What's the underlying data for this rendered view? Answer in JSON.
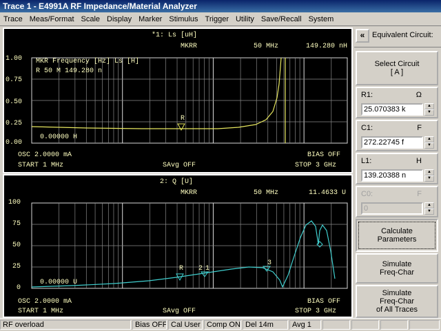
{
  "window": {
    "title": "Trace 1  -  E4991A RF Impedance/Material Analyzer"
  },
  "menu": [
    "Trace",
    "Meas/Format",
    "Scale",
    "Display",
    "Marker",
    "Stimulus",
    "Trigger",
    "Utility",
    "Save/Recall",
    "System"
  ],
  "trace1": {
    "title": "*1: Ls [uH]",
    "mkr_mode": "MKRR",
    "mkr_freq": "50 MHz",
    "mkr_value": "149.280 nH",
    "table_header": "MKR  Frequency  [Hz]       Ls [H]",
    "table_row": " R              50 M    149.280 n",
    "yticks": [
      "1.00",
      "0.75",
      "0.50",
      "0.25",
      "0.00"
    ],
    "ref_value": "0.00000 H",
    "osc": "OSC 2.0000 mA",
    "bias": "BIAS OFF",
    "start": "START  1 MHz",
    "savg": "SAvg OFF",
    "stop": "STOP  3 GHz",
    "marker_label": "R",
    "trace_color": "#e8e860"
  },
  "trace2": {
    "title": "2: Q [U]",
    "mkr_mode": "MKRR",
    "mkr_freq": "50 MHz",
    "mkr_value": "11.4633 U",
    "yticks": [
      "100",
      "75",
      "50",
      "25",
      "0"
    ],
    "ref_value": "0.00000 U",
    "osc": "OSC 2.0000 mA",
    "bias": "BIAS OFF",
    "start": "START  1 MHz",
    "savg": "SAvg OFF",
    "stop": "STOP  3 GHz",
    "marker_labels": [
      "R",
      "2",
      "1",
      "3"
    ],
    "trace_color": "#40d0d0"
  },
  "side": {
    "back": "«",
    "title": "Equivalent Circuit:",
    "select_circuit": "Select Circuit",
    "select_circuit_value": "[ A ]",
    "fields": [
      {
        "label": "R1:",
        "unit": "Ω",
        "value": "25.070383 k",
        "enabled": true
      },
      {
        "label": "C1:",
        "unit": "F",
        "value": "272.22745 f",
        "enabled": true
      },
      {
        "label": "L1:",
        "unit": "H",
        "value": "139.20388 n",
        "enabled": true
      },
      {
        "label": "C0:",
        "unit": "F",
        "value": "0",
        "enabled": false
      }
    ],
    "calc_line1": "Calculate",
    "calc_line2": "Parameters",
    "sim_line1": "Simulate",
    "sim_line2": "Freq-Char",
    "simall_line1": "Simulate",
    "simall_line2": "Freq-Char",
    "simall_line3": "of All Traces"
  },
  "status": {
    "message": "RF overload",
    "bias": "Bias OFF",
    "cal": "Cal User",
    "comp": "Comp ON",
    "delay": "Del 14m",
    "avg": "Avg   1"
  }
}
